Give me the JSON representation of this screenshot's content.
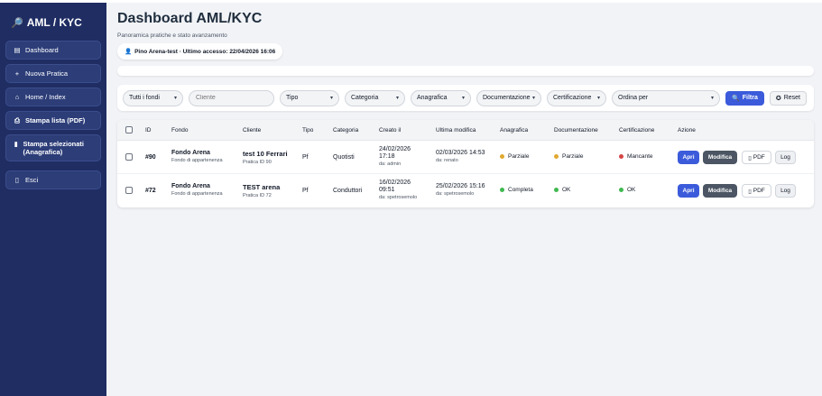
{
  "sidebar": {
    "brand": "AML / KYC",
    "brand_icon": "🔎",
    "items": [
      {
        "icon": "▤",
        "icon_name": "dashboard-icon",
        "label": "Dashboard"
      },
      {
        "icon": "+",
        "icon_name": "plus-icon",
        "label": "Nuova Pratica"
      },
      {
        "icon": "⌂",
        "icon_name": "home-icon",
        "label": "Home / Index"
      },
      {
        "icon": "⎙",
        "icon_name": "printer-icon",
        "label": "Stampa lista (PDF)"
      },
      {
        "icon": "▮",
        "icon_name": "print-selected-icon",
        "label": "Stampa selezionati (Anagrafica)"
      },
      {
        "icon": "▯",
        "icon_name": "door-icon",
        "label": "Esci"
      }
    ]
  },
  "header": {
    "title": "Dashboard AML/KYC",
    "subtitle": "Panoramica pratiche e stato avanzamento",
    "user_icon": "👤",
    "user_info": "Pino Arena-test · Ultimo accesso: 22/04/2026 16:06"
  },
  "filters": {
    "fondi": "Tutti i fondi",
    "cliente_placeholder": "Cliente",
    "tipo": "Tipo",
    "categoria": "Categoria",
    "anagrafica": "Anagrafica",
    "documentazione": "Documentazione",
    "certificazione": "Certificazione",
    "ordina": "Ordina per",
    "filtra_label": "Filtra",
    "reset_label": "Reset"
  },
  "table": {
    "headers": {
      "id": "ID",
      "fondo": "Fondo",
      "cliente": "Cliente",
      "tipo": "Tipo",
      "categoria": "Categoria",
      "creato": "Creato il",
      "modifica": "Ultima modifica",
      "anagrafica": "Anagrafica",
      "documentazione": "Documentazione",
      "certificazione": "Certificazione",
      "azione": "Azione"
    },
    "rows": [
      {
        "id": "#90",
        "fondo": "Fondo Arena",
        "fondo_sub": "Fondo di appartenenza",
        "cliente": "test 10 Ferrari",
        "cliente_sub": "Pratica ID 90",
        "tipo": "Pf",
        "categoria": "Quotisti",
        "creato_date": "24/02/2026",
        "creato_time": "17:18",
        "creato_by": "da: admin",
        "modifica_date": "02/03/2026 14:53",
        "modifica_by": "da: renato",
        "anagrafica": "Parziale",
        "anagrafica_color": "#e0a82e",
        "documentazione": "Parziale",
        "documentazione_color": "#e0a82e",
        "certificazione": "Mancante",
        "certificazione_color": "#d64545"
      },
      {
        "id": "#72",
        "fondo": "Fondo Arena",
        "fondo_sub": "Fondo di appartenenza",
        "cliente": "TEST arena",
        "cliente_sub": "Pratica ID 72",
        "tipo": "Pf",
        "categoria": "Conduttori",
        "creato_date": "16/02/2026",
        "creato_time": "09:51",
        "creato_by": "da: spetrosemolo",
        "modifica_date": "25/02/2026 15:16",
        "modifica_by": "da: spetrosemolo",
        "anagrafica": "Completa",
        "anagrafica_color": "#3fb950",
        "documentazione": "OK",
        "documentazione_color": "#3fb950",
        "certificazione": "OK",
        "certificazione_color": "#3fb950"
      }
    ],
    "actions": {
      "apri": "Apri",
      "modifica": "Modifica",
      "pdf": "PDF",
      "log": "Log"
    }
  }
}
